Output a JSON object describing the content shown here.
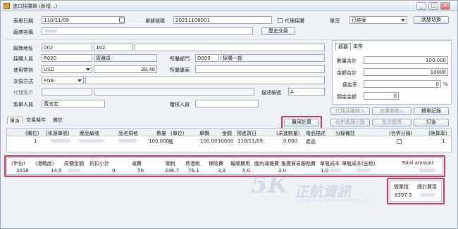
{
  "window": {
    "title": "進口採購單 (新增...)",
    "minimize": "_",
    "restore": "□",
    "close": "×"
  },
  "header": {
    "order_date_label": "表單日期",
    "order_date_value": "110/11/09",
    "order_no_label": "單據號碼",
    "order_no_value": "20211109001",
    "proxy_label": "代理採購",
    "status_label": "單況",
    "status_value": "已結案",
    "switch_status_button": "狀態切換",
    "vendor_name_label": "廠商名稱",
    "history_button": "歷史交易"
  },
  "form": {
    "vendor_address_label": "廠商地址",
    "address_code1": "002",
    "address_code2": "102",
    "buyer_label": "採購人員",
    "buyer_code": "R020",
    "buyer_name": "周雅貞",
    "dept_label": "所屬部門",
    "dept_code": "D009",
    "dept_name": "採購一部",
    "currency_label": "使用幣別",
    "currency_value": "USD",
    "exchange_rate": "28.40",
    "project_label": "所屬專案",
    "trade_label": "交易方式",
    "trade_value": "FOB",
    "agent_label": "代理客戶",
    "desc_no_label": "描述編號",
    "desc_no_value": "A",
    "maker_label": "製單人員",
    "maker_name": "黃志宏",
    "reviewer_label": "覆核人員"
  },
  "summary": {
    "tab_summary": "摘要",
    "tab_note": "本幣",
    "qty_total_label": "數量合計",
    "qty_total_value": "100.000",
    "amount_total_label": "金額合計",
    "amount_total_value": "10000",
    "commission_rate_label": "佣金率",
    "commission_rate_value": "0",
    "percent": "%",
    "commission_amount_label": "佣金金額",
    "commission_amount_value": "0"
  },
  "tabs": [
    "單身",
    "交易條件",
    "備註"
  ],
  "buttons": {
    "cost_calc": "費用計算",
    "proxy_import": "代理採購轉入",
    "quote_import": "詢價單轉入",
    "change_record": "轉單記錄",
    "merge_split": "合併處理分錄",
    "batch_delivery": "批次撥貨",
    "deposit": "訂金"
  },
  "grid": {
    "headers": [
      "(欄位)",
      "(來源單號)",
      "產品編號",
      "品名規格",
      "數量",
      "(單位)",
      "單價",
      "金額",
      "預進貨日",
      "(未進數量)",
      "贈品描述",
      "分錄備註",
      "(合併分錄)",
      "(換算率)"
    ],
    "row": {
      "seq": "1",
      "qty": "100.000",
      "unit": "瓶",
      "price": "100.00",
      "amount": "10000",
      "date": "110/11/09",
      "remaining": "0.000",
      "gift": "產品",
      "rate": "1"
    }
  },
  "cost_table": {
    "headers": [
      "(年份)",
      "(酒精度)",
      "原價金額",
      "折扣小計",
      "運費",
      "關稅",
      "菸酒稅",
      "保險費",
      "報關費用",
      "國內運雜費",
      "推廣貿易服務費",
      "單瓶成本",
      "單瓶成本(含稅)",
      "Total amount"
    ],
    "values": [
      "2018",
      "14.5",
      "",
      "0",
      "50",
      "246.7",
      "76.1",
      "3.3",
      "5.0",
      "3.0",
      "1.0",
      "",
      "",
      ""
    ]
  },
  "tax_box": {
    "business_tax_label": "營業稅",
    "total_cost_label": "總計費用",
    "business_tax_value": "8397.3"
  },
  "watermark": {
    "logo": "5K",
    "brand": "正航資訊",
    "english": "CHENG HANG INFORMATION CO.,LTD"
  },
  "colors": {
    "highlight": "#c23a62",
    "title_bg": "#dde4ec",
    "accent": "#d2a13d"
  }
}
